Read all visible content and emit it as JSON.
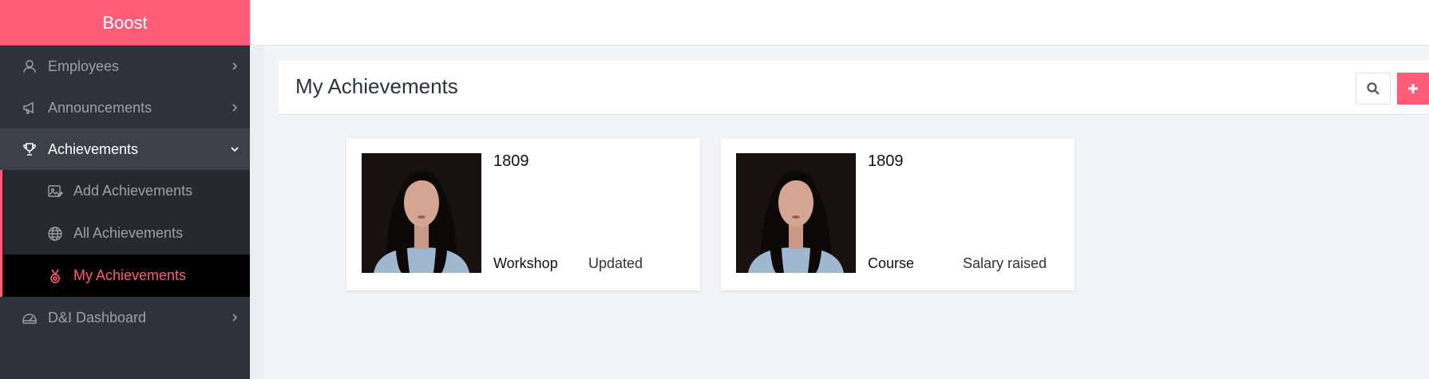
{
  "brand": "Boost",
  "nav": {
    "employees": "Employees",
    "announcements": "Announcements",
    "achievements": "Achievements",
    "add_achievements": "Add Achievements",
    "all_achievements": "All Achievements",
    "my_achievements": "My Achievements",
    "dni_dashboard": "D&I Dashboard"
  },
  "page": {
    "title": "My Achievements"
  },
  "cards": [
    {
      "number": "1809",
      "type": "Workshop",
      "status": "Updated"
    },
    {
      "number": "1809",
      "type": "Course",
      "status": "Salary raised"
    }
  ],
  "colors": {
    "accent": "#ff5e78",
    "sidebar": "#2d333b",
    "sidebar_active": "#000000"
  },
  "icons": {
    "employees": "user-icon",
    "announcements": "megaphone-icon",
    "achievements": "trophy-icon",
    "add_achievements": "image-edit-icon",
    "all_achievements": "globe-icon",
    "my_achievements": "medal-icon",
    "dni_dashboard": "gauge-icon"
  }
}
